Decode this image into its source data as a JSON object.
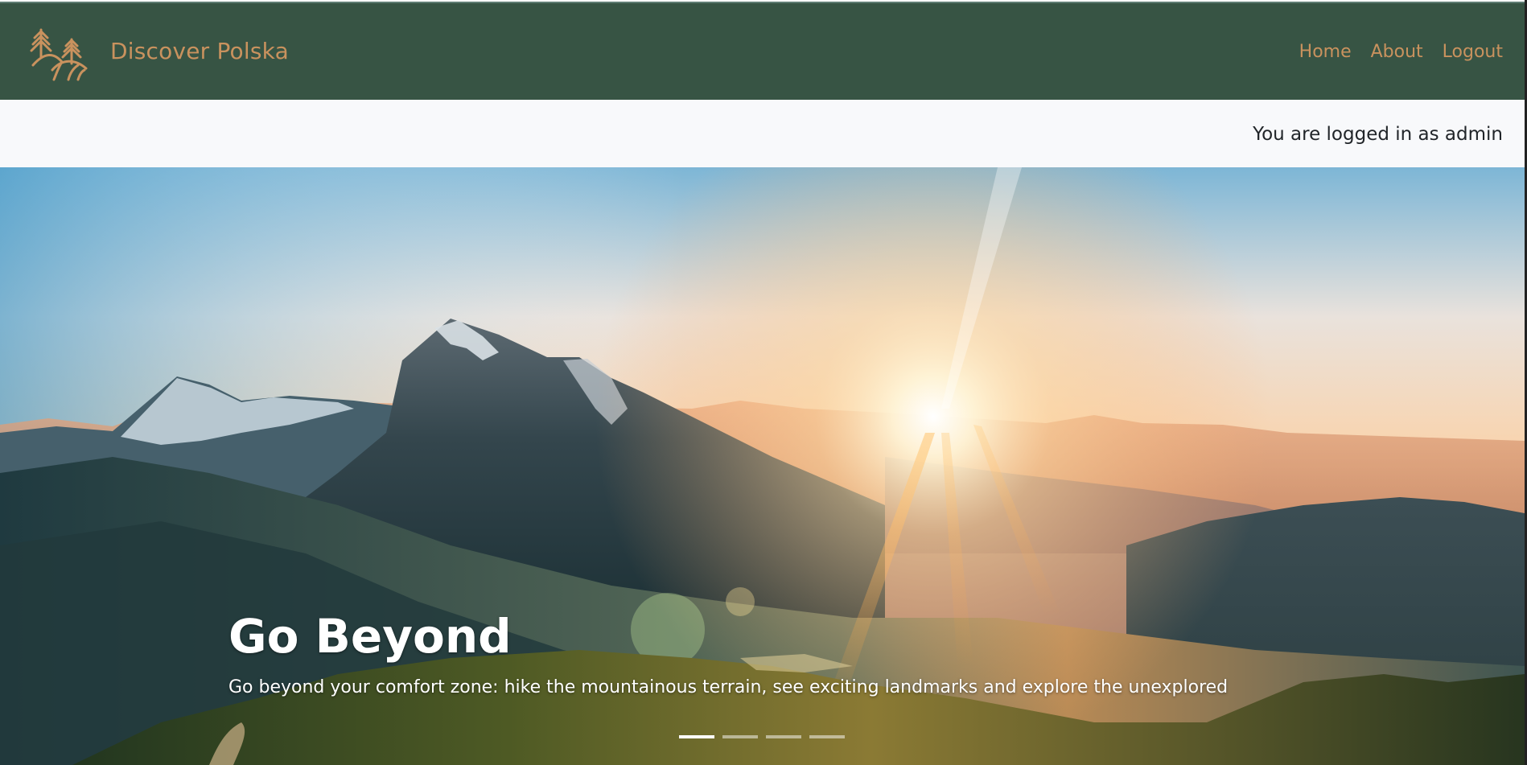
{
  "navbar": {
    "brand_name": "Discover Polska",
    "logo_icon": "trees-landscape-icon",
    "links": [
      {
        "label": "Home"
      },
      {
        "label": "About"
      },
      {
        "label": "Logout"
      }
    ]
  },
  "status_bar": {
    "message": "You are logged in as admin"
  },
  "carousel": {
    "slide_title": "Go Beyond",
    "slide_text": "Go beyond your comfort zone: hike the mountainous terrain, see exciting landmarks and explore the unexplored",
    "slide_count": 4,
    "active_slide": 1
  },
  "colors": {
    "navbar_bg": "#375444",
    "brand_accent": "#c9925e",
    "subbar_bg": "#f8f9fb",
    "text_dark": "#212529"
  }
}
